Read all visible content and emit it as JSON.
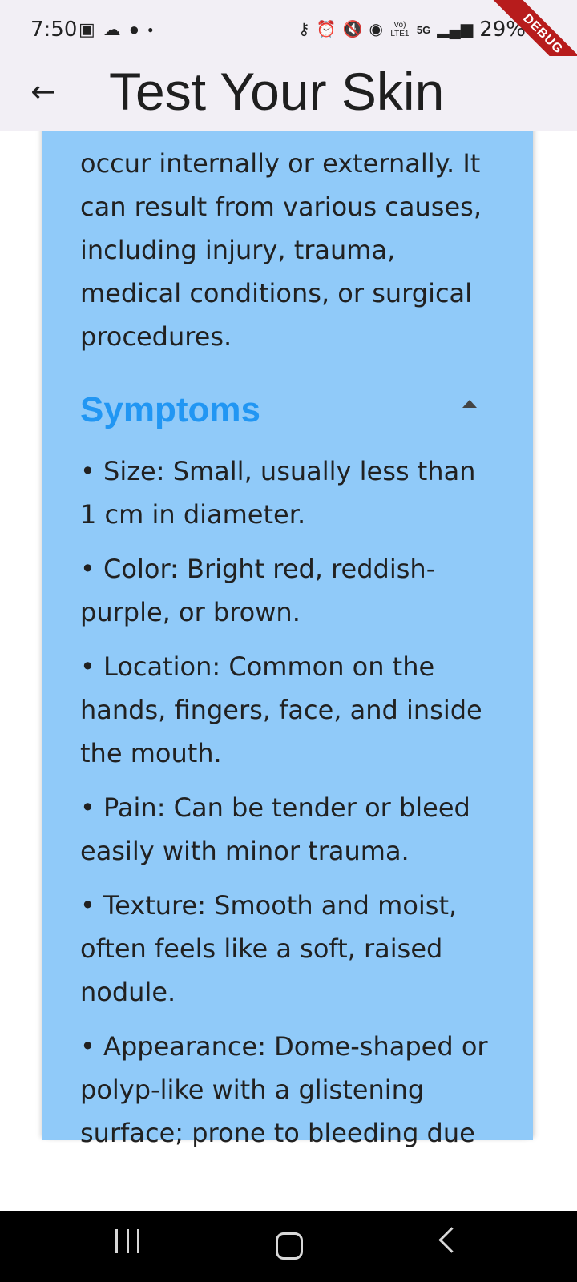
{
  "status_bar": {
    "time": "7:50",
    "left_icons": [
      "gallery-icon",
      "cloud-icon",
      "chat-icon",
      "dot-icon"
    ],
    "right_icons": [
      "key-icon",
      "alarm-icon",
      "mute-icon",
      "hotspot-icon",
      "volte-icon",
      "5g-icon",
      "signal-icon"
    ],
    "volte_label": "Vo) LTE1",
    "network_label": "5G",
    "battery": "29%",
    "debug_label": "DEBUG"
  },
  "app_bar": {
    "title": "Test Your Skin",
    "back_icon": "arrow-left-icon"
  },
  "card": {
    "background": "#90caf9",
    "description": "occur internally or externally. It can result from various causes, including injury, trauma, medical conditions, or surgical procedures.",
    "section_title": "Symptoms",
    "section_title_color": "#2196f3",
    "symptoms": [
      "• Size: Small, usually less than 1 cm in diameter.",
      "• Color: Bright red, reddish-purple, or brown.",
      "• Location: Common on the hands, fingers, face, and inside the mouth.",
      "• Pain: Can be tender or bleed easily with minor trauma.",
      "• Texture: Smooth and moist, often feels like a soft, raised nodule.",
      "• Appearance: Dome-shaped or polyp-like with a glistening surface; prone to bleeding due"
    ]
  },
  "nav_bar": {
    "buttons": [
      "recents-icon",
      "home-icon",
      "back-icon"
    ]
  }
}
